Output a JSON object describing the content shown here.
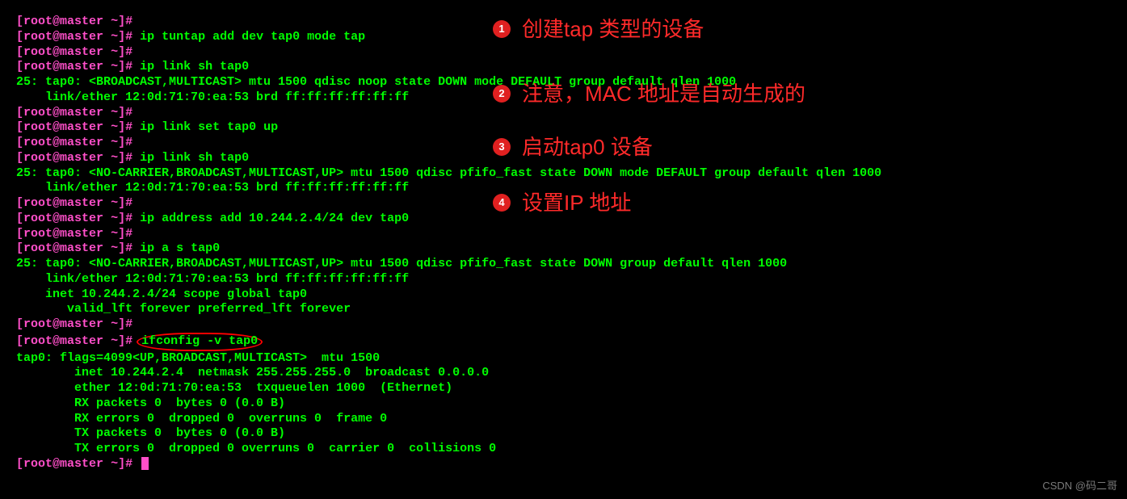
{
  "prompt": {
    "open": "[",
    "user": "root@master",
    "sep": " ",
    "path": "~",
    "close": "]",
    "hash": "# "
  },
  "lines": {
    "l1_cmd": "",
    "l2_cmd": "ip tuntap add dev tap0 mode tap",
    "l3_cmd": "",
    "l4_cmd": "ip link sh tap0",
    "l5_out": "25: tap0: <BROADCAST,MULTICAST> mtu 1500 qdisc noop state DOWN mode DEFAULT group default qlen 1000",
    "l6_out": "    link/ether 12:0d:71:70:ea:53 brd ff:ff:ff:ff:ff:ff",
    "l7_cmd": "",
    "l8_cmd": "ip link set tap0 up",
    "l9_cmd": "",
    "l10_cmd": "ip link sh tap0",
    "l11_out": "25: tap0: <NO-CARRIER,BROADCAST,MULTICAST,UP> mtu 1500 qdisc pfifo_fast state DOWN mode DEFAULT group default qlen 1000",
    "l12_out": "    link/ether 12:0d:71:70:ea:53 brd ff:ff:ff:ff:ff:ff",
    "l13_cmd": "",
    "l14_cmd": "ip address add 10.244.2.4/24 dev tap0",
    "l15_cmd": "",
    "l16_cmd": "ip a s tap0",
    "l17_out": "25: tap0: <NO-CARRIER,BROADCAST,MULTICAST,UP> mtu 1500 qdisc pfifo_fast state DOWN group default qlen 1000",
    "l18_out": "    link/ether 12:0d:71:70:ea:53 brd ff:ff:ff:ff:ff:ff",
    "l19_out": "    inet 10.244.2.4/24 scope global tap0",
    "l20_out": "       valid_lft forever preferred_lft forever",
    "l21_cmd": "",
    "l22_cmd": "ifconfig -v tap0",
    "l23_out": "tap0: flags=4099<UP,BROADCAST,MULTICAST>  mtu 1500",
    "l24_out": "        inet 10.244.2.4  netmask 255.255.255.0  broadcast 0.0.0.0",
    "l25_out": "        ether 12:0d:71:70:ea:53  txqueuelen 1000  (Ethernet)",
    "l26_out": "        RX packets 0  bytes 0 (0.0 B)",
    "l27_out": "        RX errors 0  dropped 0  overruns 0  frame 0",
    "l28_out": "        TX packets 0  bytes 0 (0.0 B)",
    "l29_out": "        TX errors 0  dropped 0 overruns 0  carrier 0  collisions 0",
    "l30_blank": "",
    "l31_cmd": ""
  },
  "annotations": {
    "a1": {
      "num": "1",
      "text": "创建tap 类型的设备"
    },
    "a2": {
      "num": "2",
      "text": "注意，MAC 地址是自动生成的"
    },
    "a3": {
      "num": "3",
      "text": "启动tap0 设备"
    },
    "a4": {
      "num": "4",
      "text": "设置IP 地址"
    }
  },
  "watermark": "CSDN @码二哥"
}
